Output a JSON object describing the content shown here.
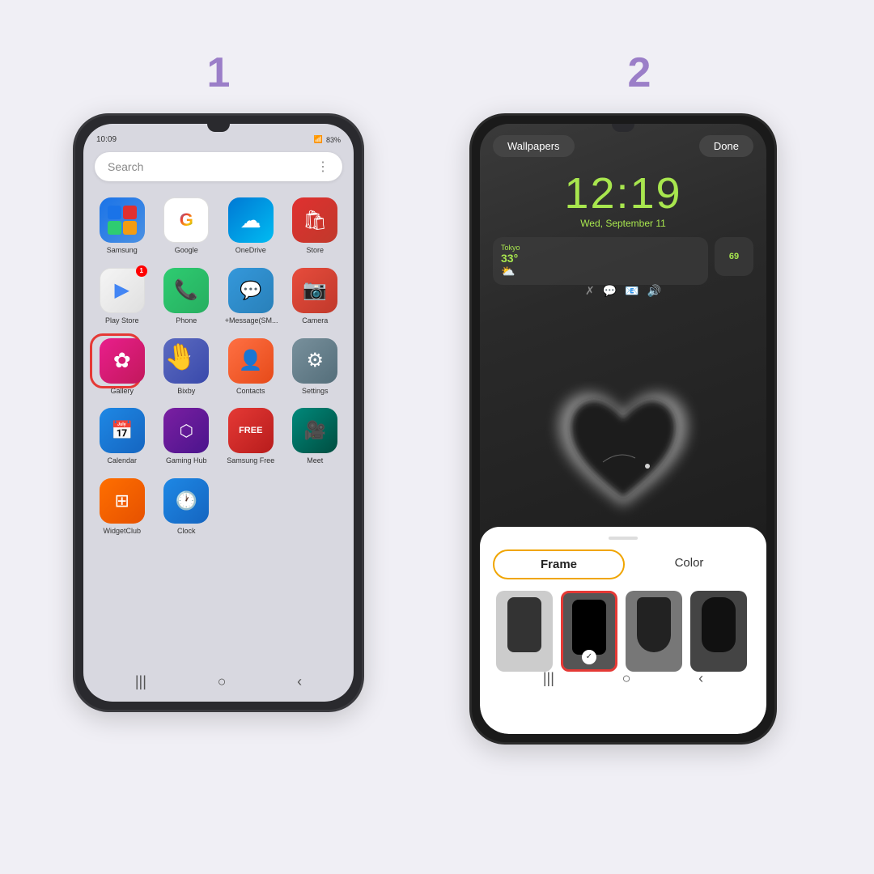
{
  "background_color": "#f0eff5",
  "step1": {
    "number": "1",
    "phone": {
      "status_time": "10:09",
      "status_icons": "▪ ▫ ▶",
      "battery": "83%",
      "search_placeholder": "Search",
      "apps_row1": [
        {
          "name": "Samsung",
          "icon_class": "icon-samsung",
          "emoji": ""
        },
        {
          "name": "Google",
          "icon_class": "icon-google",
          "emoji": ""
        },
        {
          "name": "OneDrive",
          "icon_class": "icon-onedrive",
          "emoji": "☁"
        },
        {
          "name": "Store",
          "icon_class": "icon-store",
          "emoji": "🛍"
        }
      ],
      "apps_row2": [
        {
          "name": "Play Store",
          "icon_class": "icon-playstore",
          "emoji": "▶",
          "badge": "1"
        },
        {
          "name": "Phone",
          "icon_class": "icon-phone",
          "emoji": "📞"
        },
        {
          "name": "+Message(SM...",
          "icon_class": "icon-message",
          "emoji": "💬"
        },
        {
          "name": "Camera",
          "icon_class": "icon-camera",
          "emoji": "📷"
        }
      ],
      "apps_row3": [
        {
          "name": "Gallery",
          "icon_class": "icon-gallery",
          "emoji": "✿",
          "highlighted": true
        },
        {
          "name": "Bixby",
          "icon_class": "icon-bixby",
          "emoji": "✓"
        },
        {
          "name": "Contacts",
          "icon_class": "icon-contacts",
          "emoji": "👤"
        },
        {
          "name": "Settings",
          "icon_class": "icon-settings",
          "emoji": "⚙"
        }
      ],
      "apps_row4": [
        {
          "name": "Calendar",
          "icon_class": "icon-calendar",
          "emoji": "📅"
        },
        {
          "name": "Gaming Hub",
          "icon_class": "icon-gaminghub",
          "emoji": "⬡"
        },
        {
          "name": "Samsung Free",
          "icon_class": "icon-samsungfree",
          "emoji": "FREE"
        },
        {
          "name": "Meet",
          "icon_class": "icon-meet",
          "emoji": "🎥"
        }
      ],
      "apps_row5": [
        {
          "name": "WidgetClub",
          "icon_class": "icon-widgetclub",
          "emoji": "⊞"
        },
        {
          "name": "Clock",
          "icon_class": "icon-clock",
          "emoji": "🕐"
        }
      ]
    }
  },
  "step2": {
    "number": "2",
    "phone": {
      "wallpapers_btn": "Wallpapers",
      "done_btn": "Done",
      "lock_time": "12:19",
      "lock_date": "Wed, September 11",
      "weather_city": "Tokyo",
      "weather_temp": "33°",
      "weather_icon": "⛅",
      "widget_num": "69",
      "notif_icons": "🔔 💬 📧 🔊",
      "panel": {
        "drag_label": "",
        "tab_frame": "Frame",
        "tab_color": "Color",
        "active_tab": "frame",
        "frames": [
          {
            "id": 1,
            "style": "opt1",
            "selected": false
          },
          {
            "id": 2,
            "style": "opt2",
            "selected": true
          },
          {
            "id": 3,
            "style": "opt3",
            "selected": false
          },
          {
            "id": 4,
            "style": "opt4",
            "selected": false
          },
          {
            "id": 5,
            "style": "opt5",
            "selected": false
          }
        ]
      }
    }
  }
}
